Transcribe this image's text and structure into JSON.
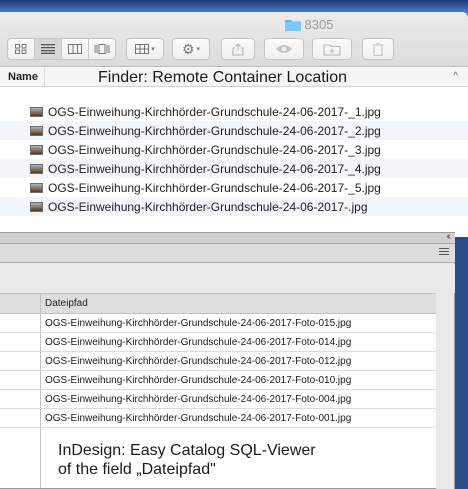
{
  "finder": {
    "window_title": "8305",
    "column_name": "Name",
    "caption": "Finder: Remote Container Location",
    "files": [
      "OGS-Einweihung-Kirchhörder-Grundschule-24-06-2017-_1.jpg",
      "OGS-Einweihung-Kirchhörder-Grundschule-24-06-2017-_2.jpg",
      "OGS-Einweihung-Kirchhörder-Grundschule-24-06-2017-_3.jpg",
      "OGS-Einweihung-Kirchhörder-Grundschule-24-06-2017-_4.jpg",
      "OGS-Einweihung-Kirchhörder-Grundschule-24-06-2017-_5.jpg",
      "OGS-Einweihung-Kirchhörder-Grundschule-24-06-2017-.jpg"
    ],
    "sort_indicator": "^"
  },
  "indesign": {
    "collapse_glyph": "‹‹",
    "column_header": "Dateipfad",
    "rows": [
      "OGS-Einweihung-Kirchhörder-Grundschule-24-06-2017-Foto-015.jpg",
      "OGS-Einweihung-Kirchhörder-Grundschule-24-06-2017-Foto-014.jpg",
      "OGS-Einweihung-Kirchhörder-Grundschule-24-06-2017-Foto-012.jpg",
      "OGS-Einweihung-Kirchhörder-Grundschule-24-06-2017-Foto-010.jpg",
      "OGS-Einweihung-Kirchhörder-Grundschule-24-06-2017-Foto-004.jpg",
      "OGS-Einweihung-Kirchhörder-Grundschule-24-06-2017-Foto-001.jpg"
    ],
    "caption_line1": "InDesign: Easy Catalog SQL-Viewer",
    "caption_line2": "of the field „Dateipfad\""
  }
}
